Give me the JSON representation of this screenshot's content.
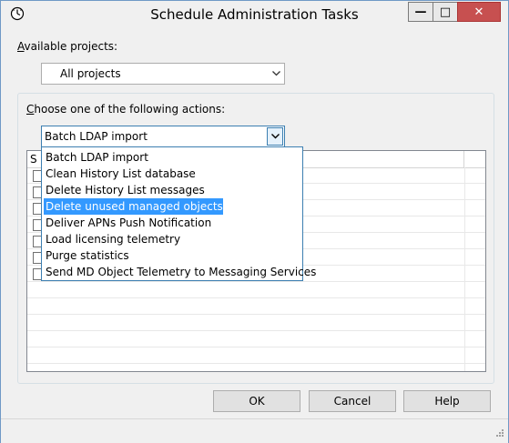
{
  "window": {
    "title": "Schedule Administration Tasks",
    "minimize": "—",
    "maximize": "□",
    "close": "✕"
  },
  "projects": {
    "label_accel": "A",
    "label_rest": "vailable projects:",
    "selected": "All projects"
  },
  "actions": {
    "label_accel": "C",
    "label_rest": "hoose one of the following actions:",
    "selected": "Batch LDAP import",
    "options": [
      "Batch LDAP import",
      "Clean History List database",
      "Delete History List messages",
      "Delete unused managed objects",
      "Deliver APNs Push Notification",
      "Load licensing telemetry",
      "Purge statistics",
      "Send MD Object Telemetry to Messaging Services"
    ],
    "highlighted_option": "Delete unused managed objects"
  },
  "grid": {
    "header_first": "S"
  },
  "buttons": {
    "ok": "OK",
    "cancel": "Cancel",
    "help": "Help"
  },
  "colors": {
    "highlight": "#3399ff",
    "close_button": "#c75050",
    "focus_border": "#3c7fb1"
  },
  "icons": {
    "app": "schedule-clock-icon",
    "dropdown": "chevron-down-icon",
    "grip": "resize-grip-icon"
  }
}
